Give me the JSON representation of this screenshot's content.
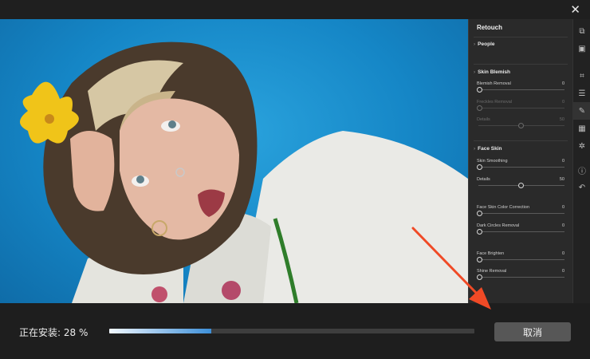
{
  "window": {
    "close_glyph": "✕"
  },
  "panel": {
    "title": "Retouch",
    "sections": {
      "people": "People",
      "skin_blemish": "Skin Blemish",
      "face_skin": "Face Skin"
    },
    "sliders": {
      "blemish_removal": {
        "label": "Blemish Removal",
        "value": "0",
        "level": 0
      },
      "freckles_removal": {
        "label": "Freckles Removal",
        "value": "0",
        "level": 0
      },
      "details_a": {
        "label": "Details",
        "value": "50",
        "level": 50
      },
      "skin_smoothing": {
        "label": "Skin Smoothing",
        "value": "0",
        "level": 0
      },
      "details_b": {
        "label": "Details",
        "value": "50",
        "level": 50
      },
      "face_skin_color": {
        "label": "Face Skin Color Correction",
        "value": "0",
        "level": 0
      },
      "dark_circles": {
        "label": "Dark Circles Removal",
        "value": "0",
        "level": 0
      },
      "face_brighten": {
        "label": "Face Brighten",
        "value": "0",
        "level": 0
      },
      "shine_removal": {
        "label": "Shine Removal",
        "value": "0",
        "level": 0
      }
    }
  },
  "toolbar": {
    "icons": [
      "layers-icon",
      "enhance-icon",
      "crop-icon",
      "adjust-icon",
      "retouch-icon",
      "grid-icon",
      "effects-icon",
      "info-icon",
      "undo-icon"
    ]
  },
  "install": {
    "status": "正在安装: 28 %",
    "progress": 0.28,
    "cancel_label": "取消"
  },
  "colors": {
    "background": "#1f1f1f",
    "photo_bg": "#1e90d0",
    "arrow": "#f04a26",
    "progress_fill": "#3d8fd8"
  }
}
